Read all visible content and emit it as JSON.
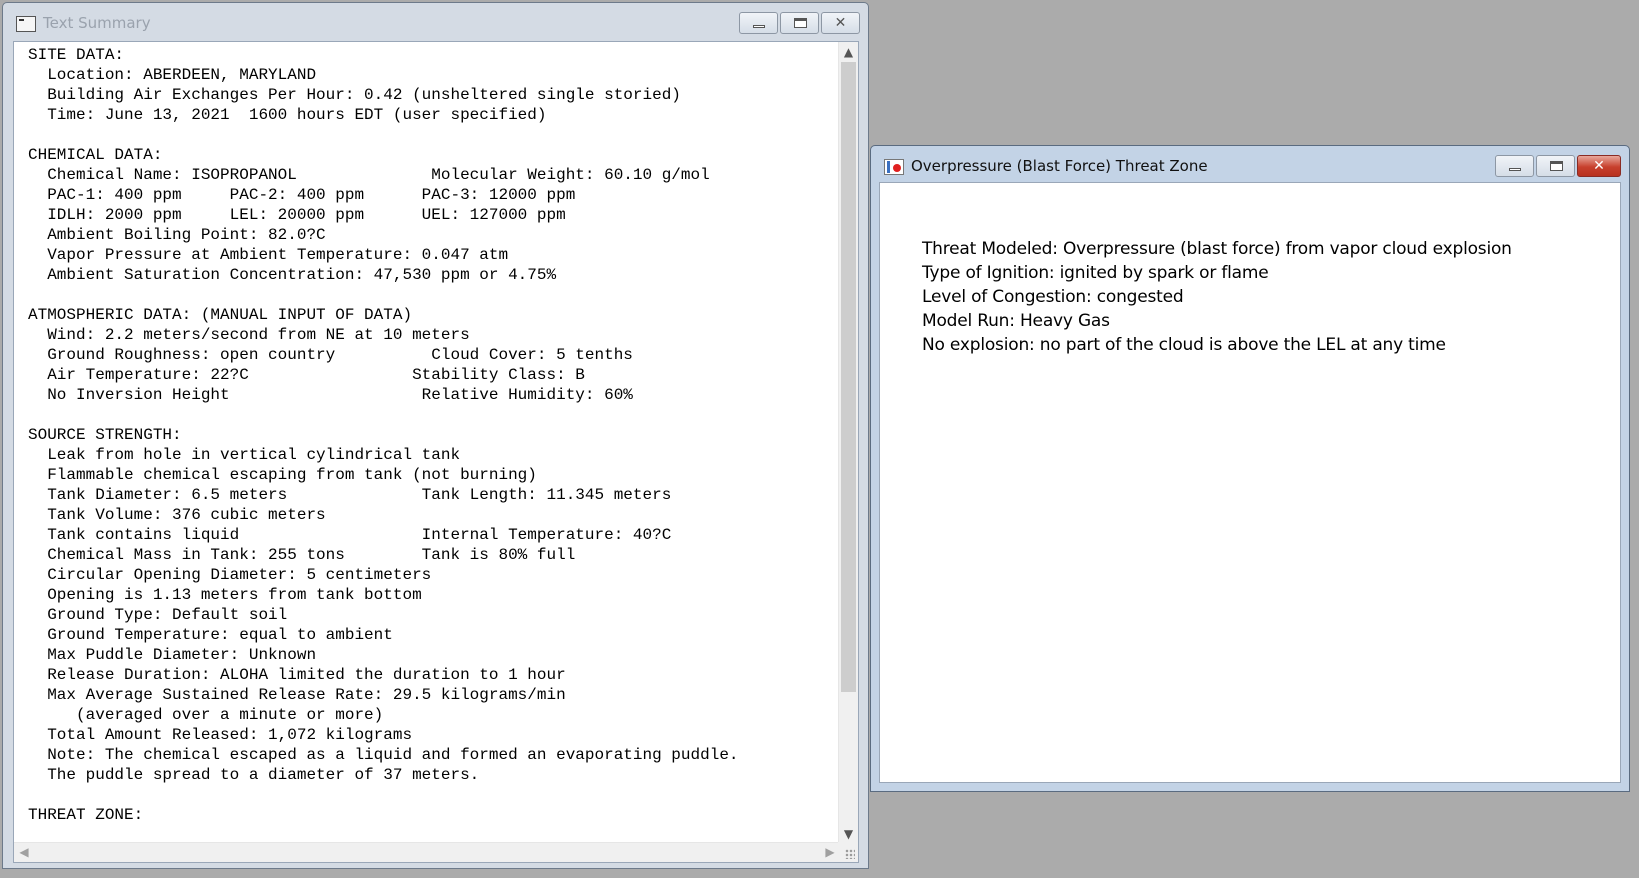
{
  "text_summary_window": {
    "title": "Text Summary",
    "buttons": {
      "minimize": "▭",
      "maximize": "□",
      "close": "✕"
    },
    "lines": [
      "SITE DATA:",
      "  Location: ABERDEEN, MARYLAND",
      "  Building Air Exchanges Per Hour: 0.42 (unsheltered single storied)",
      "  Time: June 13, 2021  1600 hours EDT (user specified)",
      "",
      "CHEMICAL DATA:",
      "  Chemical Name: ISOPROPANOL              Molecular Weight: 60.10 g/mol",
      "  PAC-1: 400 ppm     PAC-2: 400 ppm      PAC-3: 12000 ppm",
      "  IDLH: 2000 ppm     LEL: 20000 ppm      UEL: 127000 ppm",
      "  Ambient Boiling Point: 82.0?C",
      "  Vapor Pressure at Ambient Temperature: 0.047 atm",
      "  Ambient Saturation Concentration: 47,530 ppm or 4.75%",
      "",
      "ATMOSPHERIC DATA: (MANUAL INPUT OF DATA)",
      "  Wind: 2.2 meters/second from NE at 10 meters",
      "  Ground Roughness: open country          Cloud Cover: 5 tenths",
      "  Air Temperature: 22?C                 Stability Class: B",
      "  No Inversion Height                    Relative Humidity: 60%",
      "",
      "SOURCE STRENGTH:",
      "  Leak from hole in vertical cylindrical tank",
      "  Flammable chemical escaping from tank (not burning)",
      "  Tank Diameter: 6.5 meters              Tank Length: 11.345 meters",
      "  Tank Volume: 376 cubic meters",
      "  Tank contains liquid                   Internal Temperature: 40?C",
      "  Chemical Mass in Tank: 255 tons        Tank is 80% full",
      "  Circular Opening Diameter: 5 centimeters",
      "  Opening is 1.13 meters from tank bottom",
      "  Ground Type: Default soil",
      "  Ground Temperature: equal to ambient",
      "  Max Puddle Diameter: Unknown",
      "  Release Duration: ALOHA limited the duration to 1 hour",
      "  Max Average Sustained Release Rate: 29.5 kilograms/min",
      "     (averaged over a minute or more)",
      "  Total Amount Released: 1,072 kilograms",
      "  Note: The chemical escaped as a liquid and formed an evaporating puddle.",
      "  The puddle spread to a diameter of 37 meters.",
      "",
      "THREAT ZONE:"
    ],
    "scrollbar": {
      "up": "▲",
      "down": "▼",
      "left": "◀",
      "right": "▶"
    }
  },
  "threat_zone_window": {
    "title": "Overpressure (Blast Force) Threat Zone",
    "buttons": {
      "minimize": "▭",
      "maximize": "□",
      "close": "✕"
    },
    "lines": [
      "Threat Modeled: Overpressure (blast force) from vapor cloud explosion",
      "Type of Ignition: ignited by spark or flame",
      "Level of Congestion: congested",
      "Model Run: Heavy Gas",
      "No explosion: no part of the cloud is above the LEL at any time"
    ]
  }
}
